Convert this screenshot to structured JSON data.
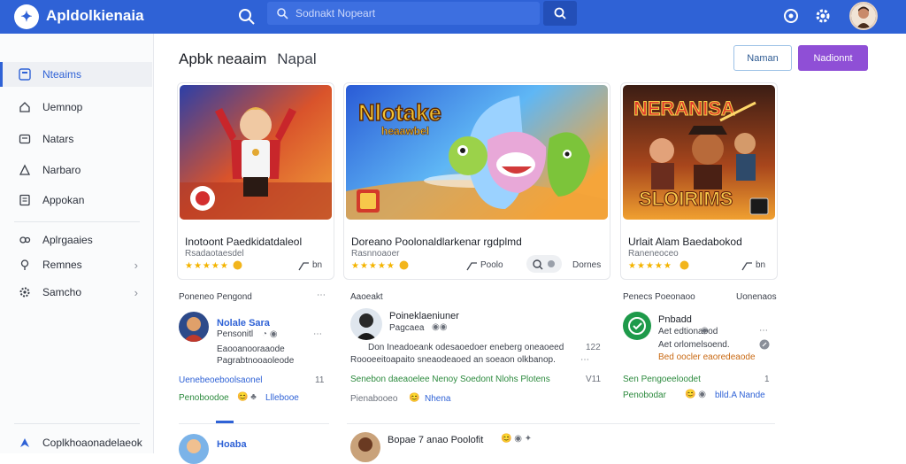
{
  "app": {
    "title": "Apldolkienaia"
  },
  "search": {
    "placeholder": "Sodnakt Nopeart"
  },
  "sidebar": {
    "items": [
      {
        "label": "Nteaims",
        "icon": "apps-icon"
      },
      {
        "label": "Uemnop",
        "icon": "home-icon"
      },
      {
        "label": "Natars",
        "icon": "message-icon"
      },
      {
        "label": "Narbaro",
        "icon": "person-icon"
      },
      {
        "label": "Appokan",
        "icon": "document-icon"
      },
      {
        "label": "Aplrgaaies",
        "icon": "group-icon"
      },
      {
        "label": "Remnes",
        "icon": "pin-icon"
      },
      {
        "label": "Samcho",
        "icon": "gear-icon"
      }
    ],
    "footer_label": "Coplkhoaonadelaeok"
  },
  "header": {
    "title": "Apbk neaaim",
    "subtitle": "Napal",
    "btn_outline": "Naman",
    "btn_primary": "Nadionnt"
  },
  "cards": [
    {
      "title": "Inotoont Paedkidatdaleol",
      "sub": "Rsadaotaesdel",
      "stars": "★★★★★",
      "action": "bn"
    },
    {
      "title": "Doreano Poolonaldlarkenar rgdplmd",
      "sub": "Rasnnoaoer",
      "stars": "★★★★★",
      "action": "Poolo",
      "action2": "Dornes"
    },
    {
      "title": "Urlait Alam Baedabokod",
      "sub": "Raneneoceo",
      "stars": "★★★★★",
      "action": "bn"
    }
  ],
  "banners": {
    "center_title": "Nlotake",
    "center_sub": "heaawbel",
    "right_title": "NERANISA",
    "right_bottom": "SLOIRIMS"
  },
  "feed": {
    "col1": {
      "header": "Poneneo Pengond",
      "name": "Nolale Sara",
      "line1": "Pensonitl",
      "line2": "Eaooanooraaode",
      "line3": "Pagrabtnooaoleode",
      "link": "Uenebeoeboolsaonel",
      "tag1": "Penoboodoe",
      "tag2": "Lllebooe",
      "count": "11",
      "footer_name": "Hoaba"
    },
    "col2": {
      "header": "Aaoeakt",
      "name": "Poineklaeniuner",
      "line1": "Pagcaea",
      "body1": "Don Ineadoeank odesaoedoer eneberg oneaoeed",
      "body2": "Roooeeitoapaito sneaodeaoed an soeaon olkbanop.",
      "num": "122",
      "link": "Senebon daeaoelee Nenoy Soedont Nlohs Plotens",
      "count": "V11",
      "tag1": "Pienabooeo",
      "tag2": "Nhena",
      "footer_name": "Bopae 7 anao Poolofit"
    },
    "col3": {
      "header": "Penecs Poeonaoo",
      "header_right": "Uonenaos",
      "name": "Pnbadd",
      "line1": "Aet edtionaood",
      "line2": "Aet orlomelsoend.",
      "line3": "Bed oocler eaoredeaode",
      "link": "Sen Pengoeeloodet",
      "count": "1",
      "tag1": "Penobodar",
      "tag2": "blld.A Nande"
    }
  },
  "colors": {
    "brand": "#2f62d6",
    "accent": "#8f4fd6",
    "star": "#f4b400"
  }
}
